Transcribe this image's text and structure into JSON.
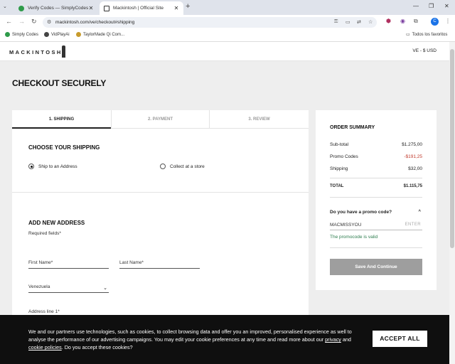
{
  "browser": {
    "tabs": [
      {
        "title": "Verify Codes — SimplyCodes",
        "active": false
      },
      {
        "title": "Mackintosh | Official Site",
        "active": true
      }
    ],
    "url": "mackintosh.com/ve/checkout#shipping",
    "bookmarks": [
      "Simply Codes",
      "VidPlayAi",
      "TaylorMade Qi Com...",
      "Todos los favoritos"
    ],
    "profile_initial": "C",
    "ext_badge": "1"
  },
  "site": {
    "logo": "MACKINTOSH",
    "currency": "VE - $ USD"
  },
  "checkout": {
    "title": "CHECKOUT SECURELY",
    "steps": [
      "1. SHIPPING",
      "2. PAYMENT",
      "3. REVIEW"
    ],
    "shipping_heading": "CHOOSE YOUR SHIPPING",
    "ship_option": "Ship to an Address",
    "collect_option": "Collect at a store",
    "address_heading": "ADD NEW ADDRESS",
    "required": "Required fields*",
    "first_name": "First Name*",
    "last_name": "Last Name*",
    "country": "Venezuela",
    "address_line": "Address line 1*"
  },
  "summary": {
    "heading": "ORDER SUMMARY",
    "subtotal_label": "Sub-total",
    "subtotal": "$1.275,00",
    "promo_label": "Promo Codes",
    "promo": "-$191,25",
    "shipping_label": "Shipping",
    "shipping": "$32,00",
    "total_label": "TOTAL",
    "total": "$1.115,75",
    "promo_question": "Do you have a promo code?",
    "promo_code": "MACMISSYOU",
    "enter_label": "ENTER",
    "valid_msg": "The promocode is valid",
    "save_button": "Save And Continue"
  },
  "cookie": {
    "text_1": "We and our partners use technologies, such as cookies, to collect browsing data and offer you an improved, personalised experience as well to analyse the performance of our advertising campaigns. You may edit your cookie preferences at any time and read more about our",
    "privacy_link": "privacy",
    "and": "and",
    "cookie_link": "cookie policies",
    "text_2": ". Do you accept these cookies?",
    "accept": "ACCEPT ALL"
  },
  "colors": {
    "promo_red": "#c0392b",
    "valid_green": "#2e7d4f",
    "button_gray": "#9e9e9e",
    "banner": "#0f0f0f"
  }
}
